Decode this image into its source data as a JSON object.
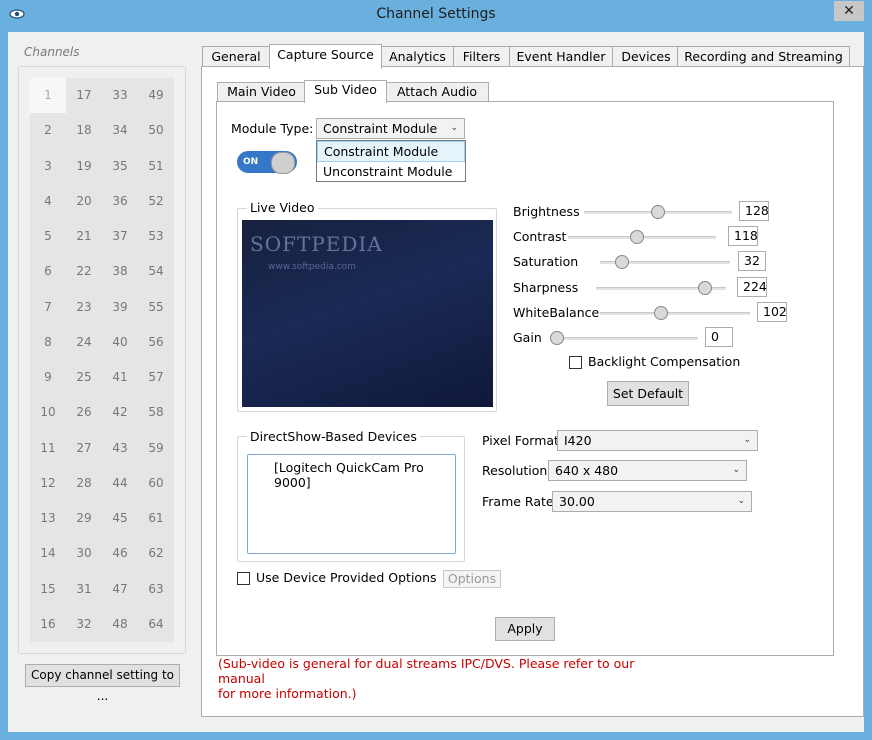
{
  "window": {
    "title": "Channel Settings",
    "close_glyph": "✕",
    "frame_color": "#6ab0de"
  },
  "channels": {
    "legend": "Channels",
    "selected": "1",
    "columns": [
      [
        "1",
        "2",
        "3",
        "4",
        "5",
        "6",
        "7",
        "8",
        "9",
        "10",
        "11",
        "12",
        "13",
        "14",
        "15",
        "16"
      ],
      [
        "17",
        "18",
        "19",
        "20",
        "21",
        "22",
        "23",
        "24",
        "25",
        "26",
        "27",
        "28",
        "29",
        "30",
        "31",
        "32"
      ],
      [
        "33",
        "34",
        "35",
        "36",
        "37",
        "38",
        "39",
        "40",
        "41",
        "42",
        "43",
        "44",
        "45",
        "46",
        "47",
        "48"
      ],
      [
        "49",
        "50",
        "51",
        "52",
        "53",
        "54",
        "55",
        "56",
        "57",
        "58",
        "59",
        "60",
        "61",
        "62",
        "63",
        "64"
      ]
    ],
    "copy_button": "Copy channel setting to ..."
  },
  "tabs": [
    "General",
    "Capture Source",
    "Analytics",
    "Filters",
    "Event Handler",
    "Devices",
    "Recording and Streaming"
  ],
  "active_tab": "Capture Source",
  "subtabs": [
    "Main Video",
    "Sub Video",
    "Attach Audio"
  ],
  "active_subtab": "Sub Video",
  "module": {
    "label": "Module Type:",
    "value": "Constraint Module",
    "options": [
      "Constraint Module",
      "Unconstraint Module"
    ],
    "highlighted": "Constraint Module"
  },
  "toggle": {
    "label": "ON",
    "state": "on"
  },
  "live_video": {
    "legend": "Live Video",
    "watermark": "SOFTPEDIA",
    "watermark_url": "www.softpedia.com"
  },
  "adjustments": [
    {
      "name": "Brightness",
      "value": "128",
      "level": 0.5
    },
    {
      "name": "Contrast",
      "value": "118",
      "level": 0.46
    },
    {
      "name": "Saturation",
      "value": "32",
      "level": 0.13
    },
    {
      "name": "Sharpness",
      "value": "224",
      "level": 0.88
    },
    {
      "name": "WhiteBalance",
      "value": "102",
      "level": 0.4
    },
    {
      "name": "Gain",
      "value": "0",
      "level": 0.0
    }
  ],
  "backlight": {
    "label": "Backlight Compensation",
    "checked": false
  },
  "set_default": "Set Default",
  "devices": {
    "legend": "DirectShow-Based Devices",
    "items": [
      "[Logitech QuickCam Pro 9000]"
    ]
  },
  "format": {
    "pixel_format_label": "Pixel Format",
    "pixel_format_value": "I420",
    "resolution_label": "Resolution",
    "resolution_value": "640 x 480",
    "frame_rate_label": "Frame Rate",
    "frame_rate_value": "30.00"
  },
  "device_options": {
    "label": "Use Device Provided Options",
    "checked": false,
    "options_button": "Options"
  },
  "apply": "Apply",
  "note_line1": "(Sub-video is general for dual streams IPC/DVS. Please refer to our manual",
  "note_line2": "for more information.)",
  "colors": {
    "note": "#c80000",
    "toggle_on": "#3777c8"
  },
  "icons": {
    "app": "eye-icon",
    "combo_arrow": "chevron-down-icon"
  }
}
